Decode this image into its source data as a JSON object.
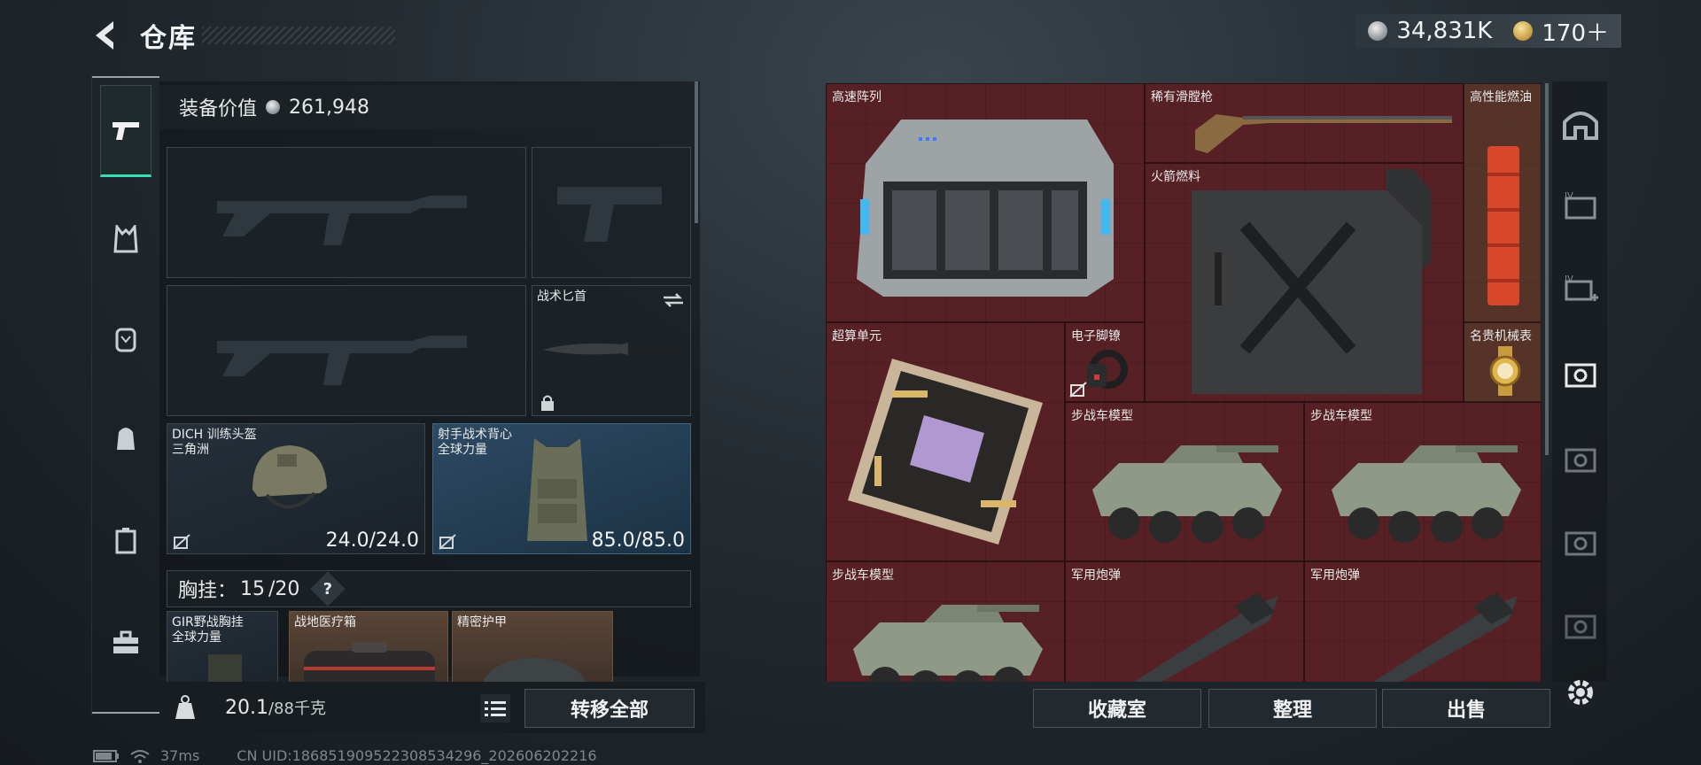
{
  "header": {
    "title": "仓库"
  },
  "currency": {
    "silver": "34,831K",
    "gold": "170＋"
  },
  "version_text": "",
  "left_panel": {
    "equipment_value_label": "装备价值",
    "equipment_value": "261,948",
    "knife_label": "战术匕首",
    "helmet": {
      "name": "DICH 训练头盔",
      "faction": "三角洲",
      "durability": "24.0/24.0"
    },
    "vest": {
      "name": "射手战术背心",
      "faction": "全球力量",
      "durability": "85.0/85.0"
    },
    "chest_rig": {
      "label": "胸挂：",
      "current": "15",
      "max": "/20",
      "help": "?"
    },
    "rig_items": [
      {
        "name": "GIR野战胸挂",
        "sub": "全球力量"
      },
      {
        "name": "战地医疗箱",
        "sub": ""
      },
      {
        "name": "精密护甲",
        "sub": ""
      }
    ],
    "weight": {
      "current": "20.1",
      "max": "/88千克"
    },
    "transfer_all": "转移全部"
  },
  "status_bar": {
    "ping": "37ms",
    "uid": "CN UID:186851909522308534296_202606202216"
  },
  "stash": {
    "items": [
      {
        "name": "高速阵列"
      },
      {
        "name": "稀有滑膛枪"
      },
      {
        "name": "高性能燃油"
      },
      {
        "name": "火箭燃料"
      },
      {
        "name": "超算单元"
      },
      {
        "name": "电子脚镣"
      },
      {
        "name": "名贵机械表"
      },
      {
        "name": "步战车模型"
      },
      {
        "name": "步战车模型"
      },
      {
        "name": "步战车模型"
      },
      {
        "name": "军用炮弹"
      },
      {
        "name": "军用炮弹"
      }
    ],
    "buttons": {
      "collection": "收藏室",
      "sort": "整理",
      "sell": "出售"
    }
  },
  "colors": {
    "accent": "#34e0b4",
    "stash_bg": "#521e22",
    "blue_slot": "#2d4a63"
  }
}
